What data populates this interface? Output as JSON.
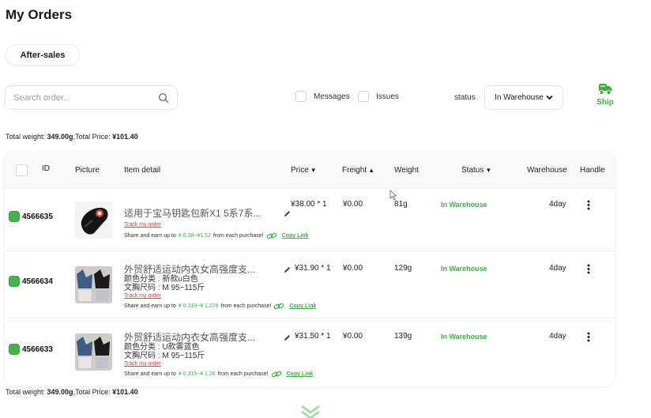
{
  "page": {
    "title": "My Orders"
  },
  "tabs": {
    "after_sales": "After-sales"
  },
  "search": {
    "placeholder": "Search order..."
  },
  "filters": {
    "messages_label": "Messages",
    "issues_label": "Issues",
    "status_label": "status",
    "status_value": "In Warehouse"
  },
  "ship": {
    "label": "Ship"
  },
  "summary": {
    "weight_prefix": "Total weight: ",
    "weight_value": "349.00g",
    "price_prefix": ",Total Price: ",
    "price_value": "¥101.40"
  },
  "table": {
    "headers": {
      "id": "ID",
      "picture": "Picture",
      "item_detail": "Item detail",
      "price": "Price",
      "freight": "Freight",
      "weight": "Weight",
      "status": "Status",
      "warehouse": "Warehouse",
      "handle": "Handle"
    },
    "rows": [
      {
        "id": "4566635",
        "title": "适用于宝马钥匙包新X1 5系7系...",
        "spec1": "",
        "spec2": "",
        "track": "Track my order",
        "share_prefix": "Share and earn up to",
        "share_range": "¥ 0.38~¥1.52",
        "share_suffix": "from each purchase!",
        "copy_link": "Copy Link",
        "price": "¥38.00 * 1",
        "freight": "¥0.00",
        "weight": "81g",
        "status": "In Warehouse",
        "warehouse": "4day"
      },
      {
        "id": "4566634",
        "title": "外贸舒适运动内衣女高强度支...",
        "spec1": "颜色分类 : 新款u白色",
        "spec2": "文胸尺码 : M 95~115斤",
        "track": "Track my order",
        "share_prefix": "Share and earn up to",
        "share_range": "¥ 0.319~¥ 1.276",
        "share_suffix": "from each purchase!",
        "copy_link": "Copy Link",
        "price": "¥31.90 * 1",
        "freight": "¥0.00",
        "weight": "129g",
        "status": "In Warehouse",
        "warehouse": "4day"
      },
      {
        "id": "4566633",
        "title": "外贸舒适运动内衣女高强度支...",
        "spec1": "颜色分类 : U款雾蓝色",
        "spec2": "文胸尺码 : M 95~115斤",
        "track": "Track my order",
        "share_prefix": "Share and earn up to",
        "share_range": "¥ 0.315~¥ 1.26",
        "share_suffix": "from each purchase!",
        "copy_link": "Copy Link",
        "price": "¥31.50 * 1",
        "freight": "¥0.00",
        "weight": "139g",
        "status": "In Warehouse",
        "warehouse": "4day"
      }
    ]
  },
  "colors": {
    "accent_green": "#3fae45",
    "alert_red": "#e03a3a"
  },
  "icons": [
    "search-icon",
    "chevron-down-icon",
    "ship-icon",
    "sort-down-icon",
    "sort-up-icon",
    "edit-icon",
    "link-icon",
    "more-vertical-icon",
    "chevron-double-down-icon"
  ]
}
